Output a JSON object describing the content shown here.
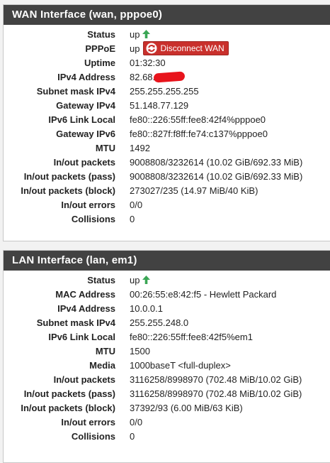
{
  "wan": {
    "title": "WAN Interface (wan, pppoe0)",
    "status_label": "Status",
    "status_value": "up",
    "pppoe_label": "PPPoE",
    "pppoe_value": "up",
    "disconnect_label": "Disconnect WAN",
    "uptime_label": "Uptime",
    "uptime_value": "01:32:30",
    "ipv4_label": "IPv4 Address",
    "ipv4_value": "82.68.",
    "subnet_label": "Subnet mask IPv4",
    "subnet_value": "255.255.255.255",
    "gw4_label": "Gateway IPv4",
    "gw4_value": "51.148.77.129",
    "ipv6ll_label": "IPv6 Link Local",
    "ipv6ll_value": "fe80::226:55ff:fee8:42f4%pppoe0",
    "gw6_label": "Gateway IPv6",
    "gw6_value": "fe80::827f:f8ff:fe74:c137%pppoe0",
    "mtu_label": "MTU",
    "mtu_value": "1492",
    "inout_label": "In/out packets",
    "inout_value": "9008808/3232614 (10.02 GiB/692.33 MiB)",
    "inout_pass_label": "In/out packets (pass)",
    "inout_pass_value": "9008808/3232614 (10.02 GiB/692.33 MiB)",
    "inout_block_label": "In/out packets (block)",
    "inout_block_value": "273027/235 (14.97 MiB/40 KiB)",
    "errors_label": "In/out errors",
    "errors_value": "0/0",
    "collisions_label": "Collisions",
    "collisions_value": "0"
  },
  "lan": {
    "title": "LAN Interface (lan, em1)",
    "status_label": "Status",
    "status_value": "up",
    "mac_label": "MAC Address",
    "mac_value": "00:26:55:e8:42:f5 - Hewlett Packard",
    "ipv4_label": "IPv4 Address",
    "ipv4_value": "10.0.0.1",
    "subnet_label": "Subnet mask IPv4",
    "subnet_value": "255.255.248.0",
    "ipv6ll_label": "IPv6 Link Local",
    "ipv6ll_value": "fe80::226:55ff:fee8:42f5%em1",
    "mtu_label": "MTU",
    "mtu_value": "1500",
    "media_label": "Media",
    "media_value": "1000baseT <full-duplex>",
    "inout_label": "In/out packets",
    "inout_value": "3116258/8998970 (702.48 MiB/10.02 GiB)",
    "inout_pass_label": "In/out packets (pass)",
    "inout_pass_value": "3116258/8998970 (702.48 MiB/10.02 GiB)",
    "inout_block_label": "In/out packets (block)",
    "inout_block_value": "37392/93 (6.00 MiB/63 KiB)",
    "errors_label": "In/out errors",
    "errors_value": "0/0",
    "collisions_label": "Collisions",
    "collisions_value": "0"
  },
  "colors": {
    "heading_bg": "#424242",
    "status_up": "#3aa655",
    "disconnect_button": "#c9302c",
    "redaction": "#e8141c"
  },
  "icons": {
    "status_up": "arrow-up-icon",
    "disconnect": "refresh-icon"
  }
}
